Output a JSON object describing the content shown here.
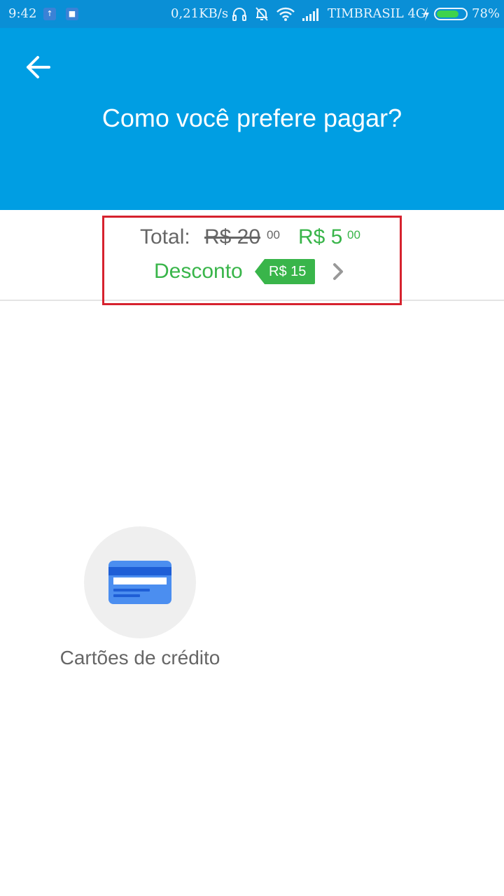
{
  "status_bar": {
    "time": "9:42",
    "net_speed": "0,21KB/s",
    "carrier": "TIMBRASIL 4G",
    "battery_percent": "78%",
    "battery_level": 0.78,
    "icons": [
      "upload-notification-icon",
      "app-notification-icon",
      "headphones-icon",
      "silent-bell-icon",
      "wifi-icon",
      "signal-icon",
      "charging-icon",
      "battery-icon"
    ]
  },
  "header": {
    "title": "Como você prefere pagar?",
    "background": "#009ee3",
    "back_icon": "arrow-left-icon"
  },
  "summary": {
    "total_label": "Total:",
    "old_price": "R$ 20",
    "old_price_cents": "00",
    "new_price": "R$ 5",
    "new_price_cents": "00",
    "discount_label": "Desconto",
    "discount_value": "R$ 15",
    "accent_color": "#39b54a",
    "highlight_color": "#d6222e"
  },
  "payment_methods": [
    {
      "label": "Cartões de crédito",
      "icon": "credit-card-icon"
    }
  ]
}
